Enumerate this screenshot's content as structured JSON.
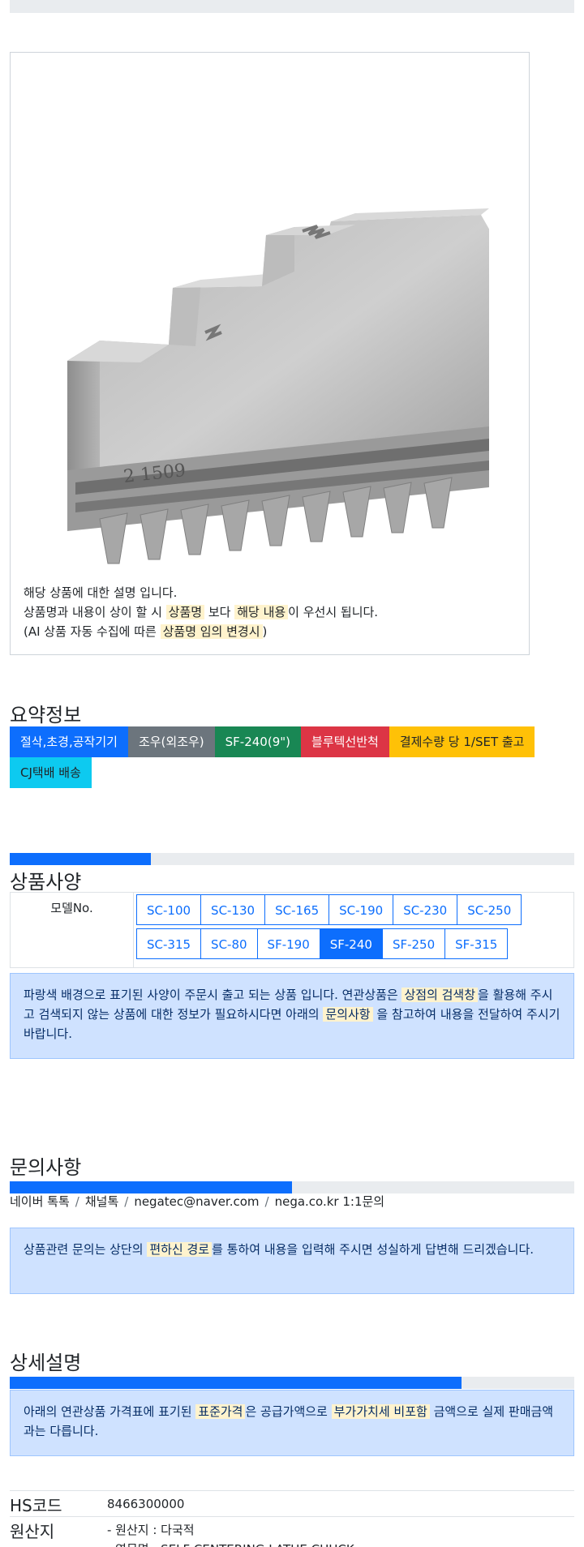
{
  "product": {
    "description_lines": [
      [
        "해당 상품에 대한 설명 입니다."
      ],
      [
        "상품명과 내용이 상이 할 시 ",
        "상품명",
        " 보다 ",
        "해당 내용",
        "이 우선시 됩니다."
      ],
      [
        "(AI 상품 자동 수집에 따른 ",
        "상품명 임의 변경시",
        ")"
      ]
    ],
    "image_stamp": "2    1509"
  },
  "summary": {
    "title": "요약정보",
    "badges": [
      {
        "label": "절삭,초경,공작기기",
        "style": "primary"
      },
      {
        "label": "조우(외조우)",
        "style": "secondary"
      },
      {
        "label": "SF-240(9\")",
        "style": "success"
      },
      {
        "label": "블루텍선반척",
        "style": "danger"
      },
      {
        "label": "결제수량 당 1/SET 출고",
        "style": "warning"
      },
      {
        "label": "CJ택배 배송",
        "style": "info"
      }
    ]
  },
  "spec": {
    "title": "상품사양",
    "progress": 0.25,
    "label": "모델No.",
    "models": [
      "SC-100",
      "SC-130",
      "SC-165",
      "SC-190",
      "SC-230",
      "SC-250",
      "SC-315",
      "SC-80",
      "SF-190",
      "SF-240",
      "SF-250",
      "SF-315"
    ],
    "active_model": "SF-240",
    "notice": [
      "파랑색 배경으로 표기된 사양이 주문시 출고 되는 상품 입니다. 연관상품은 ",
      "상점의 검색창",
      "을 활용해 주시고 검색되지 않는 상품에 대한 정보가 필요하시다면 아래의 ",
      "문의사항",
      " 을 참고하여 내용을 전달하여 주시기 바랍니다."
    ]
  },
  "inquiry": {
    "title": "문의사항",
    "progress": 0.5,
    "contacts": [
      "네이버 톡톡",
      "채널톡",
      "negatec@naver.com",
      "nega.co.kr 1:1문의"
    ],
    "notice": [
      "상품관련 문의는 상단의 ",
      "편하신 경로",
      "를 통하여 내용을 입력해 주시면 성실하게 답변해 드리겠습니다."
    ]
  },
  "detail": {
    "title": "상세설명",
    "progress": 0.8,
    "notice": [
      "아래의 연관상품 가격표에 표기된 ",
      "표준가격",
      "은 공급가액으로 ",
      "부가가치세 비포함",
      " 금액으로 실제 판매금액과는 다릅니다."
    ],
    "rows": [
      {
        "key": "HS코드",
        "values": [
          "8466300000"
        ]
      },
      {
        "key": "원산지",
        "values": [
          "- 원산지 : 다국적",
          "- 영문명 : SELF CENTERING LATHE CHUCK"
        ]
      }
    ]
  },
  "colors": {
    "primary": "#0d6efd",
    "alert_bg": "#cfe2ff",
    "highlight": "#fff3cd"
  }
}
